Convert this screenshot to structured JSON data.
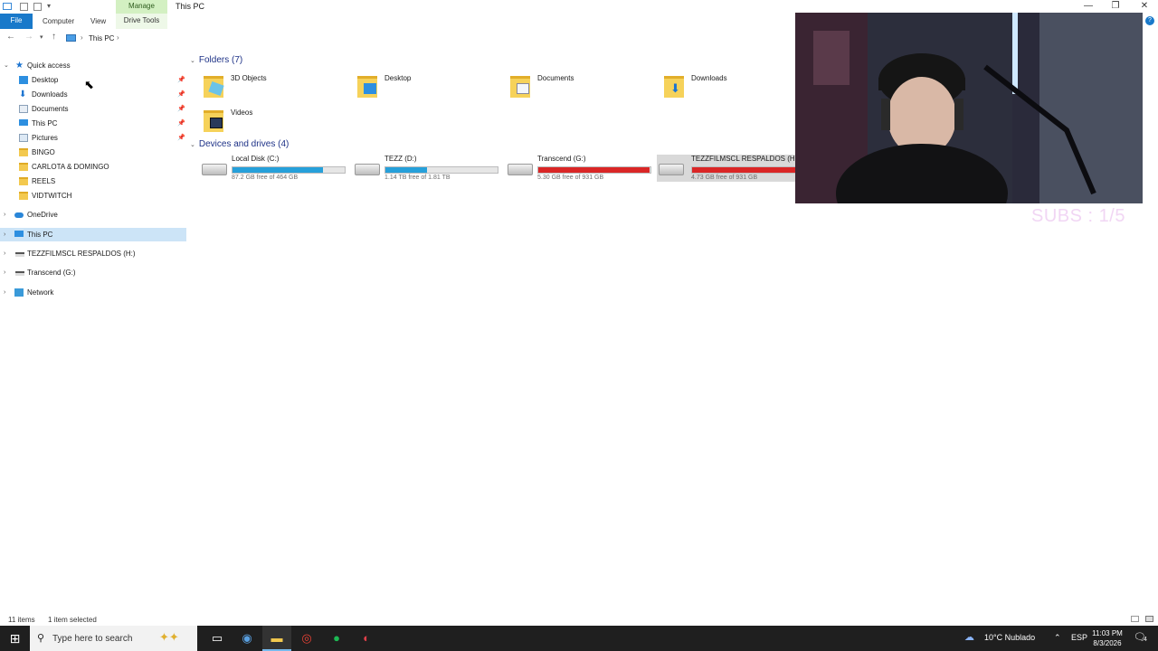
{
  "titlebar": {
    "manage_label": "Manage",
    "title": "This PC",
    "minimize": "—",
    "restore": "❐",
    "close": "✕"
  },
  "ribbon": {
    "file": "File",
    "computer": "Computer",
    "view": "View",
    "drive_tools": "Drive Tools",
    "help": "?"
  },
  "address": {
    "crumb": "This PC",
    "sep": "›"
  },
  "nav": {
    "quick_access": "Quick access",
    "pinned": [
      {
        "label": "Desktop"
      },
      {
        "label": "Downloads"
      },
      {
        "label": "Documents"
      },
      {
        "label": "This PC"
      },
      {
        "label": "Pictures"
      }
    ],
    "folders": [
      {
        "label": "BINGO"
      },
      {
        "label": "CARLOTA & DOMINGO"
      },
      {
        "label": "REELS"
      },
      {
        "label": "VIDTWITCH"
      }
    ],
    "onedrive": "OneDrive",
    "this_pc": "This PC",
    "drive_h": "TEZZFILMSCL RESPALDOS (H:)",
    "drive_g": "Transcend (G:)",
    "network": "Network"
  },
  "content": {
    "folders_header": "Folders (7)",
    "folders": [
      {
        "name": "3D Objects",
        "overlay": "3d"
      },
      {
        "name": "Desktop",
        "overlay": "desktop"
      },
      {
        "name": "Documents",
        "overlay": "doc"
      },
      {
        "name": "Downloads",
        "overlay": "down"
      },
      {
        "name": "Videos",
        "overlay": "video"
      }
    ],
    "drives_header": "Devices and drives (4)",
    "drives": [
      {
        "name": "Local Disk (C:)",
        "free": "87.2 GB free of 464 GB",
        "used_fraction": 0.81,
        "status": "normal"
      },
      {
        "name": "TEZZ (D:)",
        "free": "1.14 TB free of 1.81 TB",
        "used_fraction": 0.37,
        "status": "normal"
      },
      {
        "name": "Transcend (G:)",
        "free": "5.30 GB free of 931 GB",
        "used_fraction": 0.99,
        "status": "full"
      },
      {
        "name": "TEZZFILMSCL RESPALDOS (H:)",
        "free": "4.73 GB free of 931 GB",
        "used_fraction": 0.99,
        "status": "full"
      }
    ]
  },
  "overlay": {
    "subs": "SUBS : 1/5"
  },
  "status": {
    "items": "11 items",
    "selected": "1 item selected"
  },
  "taskbar": {
    "search_placeholder": "Type here to search",
    "weather": "10°C  Nublado",
    "lang": "ESP",
    "time": "11:03 PM",
    "date": "8/3/2026",
    "notif_count": "4"
  },
  "colors": {
    "accent": "#1979ca",
    "drive_normal": "#26a0da",
    "drive_full": "#da2626",
    "selection": "#cce4f7"
  }
}
